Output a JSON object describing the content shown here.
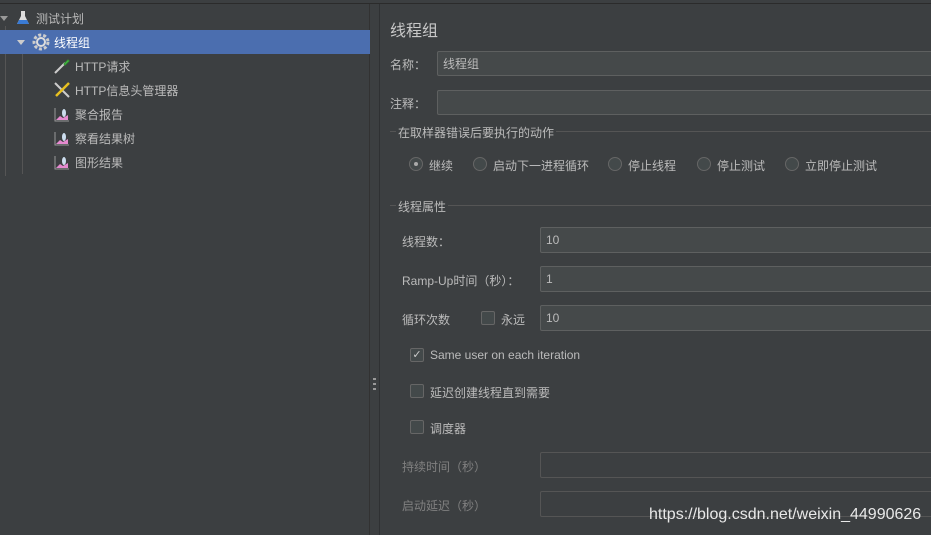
{
  "tree": [
    {
      "label": "测试计划",
      "icon": "test-plan-flask-icon"
    },
    {
      "label": "线程组",
      "icon": "thread-group-gear-icon",
      "selected": true
    },
    {
      "label": "HTTP请求",
      "icon": "http-request-pipette-icon"
    },
    {
      "label": "HTTP信息头管理器",
      "icon": "header-manager-tools-icon"
    },
    {
      "label": "聚合报告",
      "icon": "listener-graph-icon"
    },
    {
      "label": "察看结果树",
      "icon": "listener-graph-icon"
    },
    {
      "label": "图形结果",
      "icon": "listener-graph-icon"
    }
  ],
  "panel": {
    "title": "线程组",
    "name_label": "名称：",
    "name_value": "线程组",
    "comment_label": "注释：",
    "comment_value": "",
    "error_section": "在取样器错误后要执行的动作",
    "error_actions": [
      {
        "label": "继续",
        "selected": true
      },
      {
        "label": "启动下一进程循环",
        "selected": false
      },
      {
        "label": "停止线程",
        "selected": false
      },
      {
        "label": "停止测试",
        "selected": false
      },
      {
        "label": "立即停止测试",
        "selected": false
      }
    ],
    "thread_section": "线程属性",
    "threads_label": "线程数：",
    "threads_value": "10",
    "rampup_label": "Ramp-Up时间（秒）：",
    "rampup_value": "1",
    "loop_label": "循环次数",
    "forever_label": "永远",
    "forever_checked": false,
    "loop_value": "10",
    "same_user_label": "Same user on each iteration",
    "same_user_checked": true,
    "delay_label": "延迟创建线程直到需要",
    "delay_checked": false,
    "scheduler_label": "调度器",
    "scheduler_checked": false,
    "duration_label": "持续时间（秒）",
    "duration_value": "",
    "startup_delay_label": "启动延迟（秒）",
    "startup_delay_value": ""
  },
  "watermark": "https://blog.csdn.net/weixin_44990626",
  "colors": {
    "background": "#3c3f41",
    "selection": "#4b6eaf",
    "input": "#45494a"
  }
}
